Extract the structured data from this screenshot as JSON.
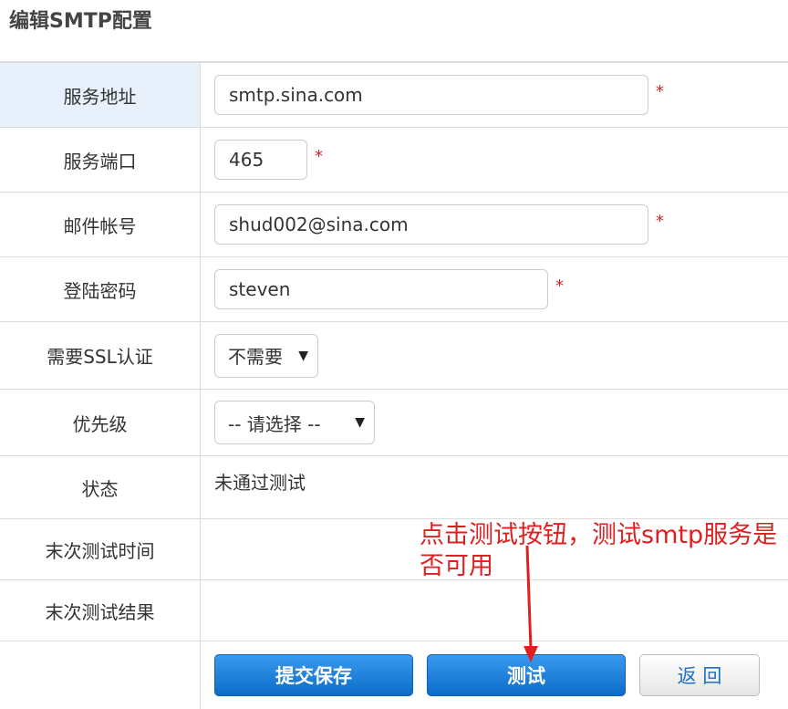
{
  "page": {
    "title": "编辑SMTP配置"
  },
  "form": {
    "server": {
      "label": "服务地址",
      "value": "smtp.sina.com",
      "required": "*"
    },
    "port": {
      "label": "服务端口",
      "value": "465",
      "required": "*"
    },
    "account": {
      "label": "邮件帐号",
      "value": "shud002@sina.com",
      "required": "*"
    },
    "password": {
      "label": "登陆密码",
      "value": "steven",
      "required": "*"
    },
    "ssl": {
      "label": "需要SSL认证",
      "selected": "不需要"
    },
    "priority": {
      "label": "优先级",
      "selected": "-- 请选择 --"
    },
    "status": {
      "label": "状态",
      "value": "未通过测试"
    },
    "last_test_time": {
      "label": "末次测试时间",
      "value": ""
    },
    "last_test_result": {
      "label": "末次测试结果",
      "value": ""
    }
  },
  "buttons": {
    "submit": "提交保存",
    "test": "测试",
    "back": "返 回"
  },
  "annotation": {
    "text": "点击测试按钮，测试smtp服务是否可用",
    "color": "#e02020"
  },
  "colors": {
    "primary_button": "#0b6cc8",
    "required_mark": "#e02020",
    "highlight_row": "#e8f1fb"
  },
  "icons": {
    "dropdown": "▼"
  }
}
